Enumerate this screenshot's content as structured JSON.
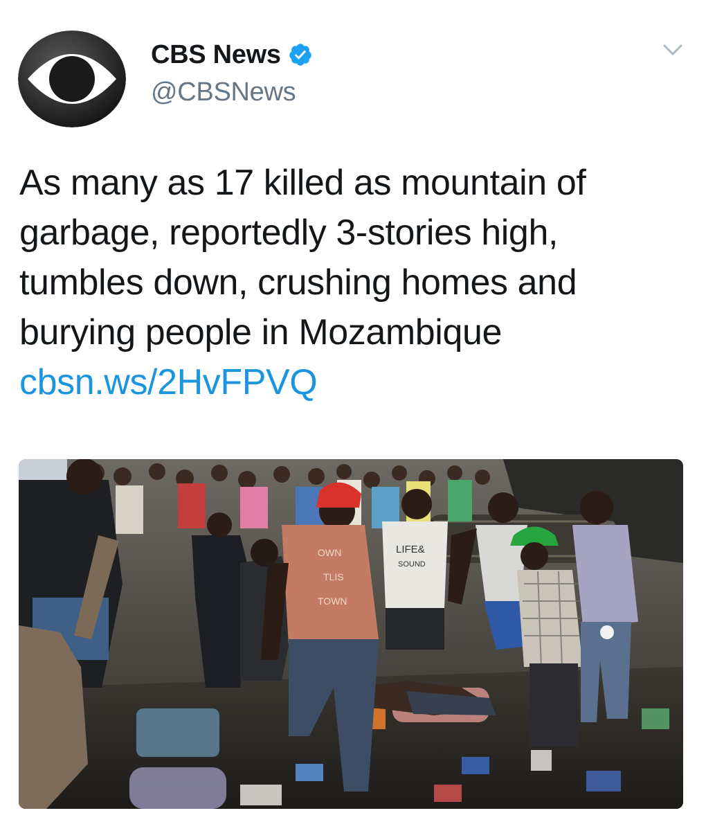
{
  "author": {
    "display_name": "CBS News",
    "handle": "@CBSNews",
    "verified": true,
    "avatar_icon": "cbs-eye-logo-icon"
  },
  "menu": {
    "icon": "chevron-down-icon"
  },
  "tweet": {
    "text": "As many as 17 killed as mountain of garbage, reportedly 3-stories high, tumbles down, crushing homes and burying people in Mozambique ",
    "link": "cbsn.ws/2HvFPVQ"
  },
  "media": {
    "shirt_text_1": "LIFE&",
    "shirt_text_2": "SOUND",
    "shirt_text_3": "OWN",
    "shirt_text_4": "TLIS",
    "shirt_text_5": "TOWN"
  },
  "colors": {
    "link": "#1b95e0",
    "verified": "#1da1f2",
    "text": "#14171a",
    "secondary": "#657786"
  }
}
